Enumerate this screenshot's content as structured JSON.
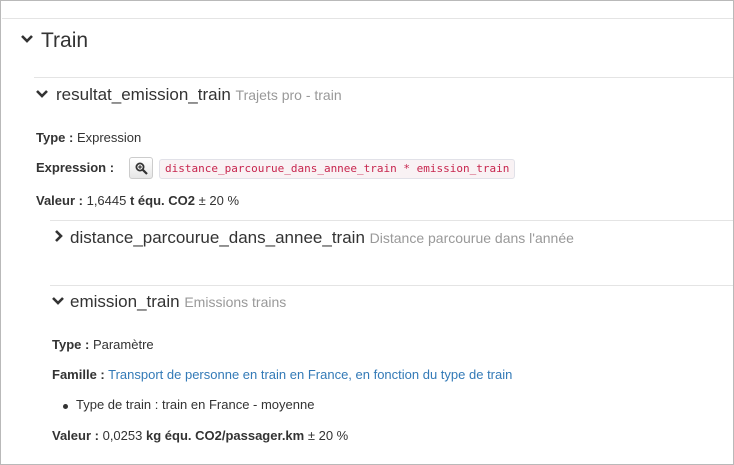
{
  "section": {
    "title": "Train"
  },
  "resultat": {
    "name": "resultat_emission_train",
    "description": "Trajets pro - train",
    "type_label": "Type :",
    "type_value": "Expression",
    "expression_label": "Expression :",
    "expression_value": "distance_parcourue_dans_annee_train * emission_train",
    "valeur_label": "Valeur :",
    "valeur_number": "1,6445",
    "valeur_unit": "t équ. CO2",
    "valeur_uncertainty": "± 20 %"
  },
  "distance": {
    "name": "distance_parcourue_dans_annee_train",
    "description": "Distance parcourue dans l'année"
  },
  "emission": {
    "name": "emission_train",
    "description": "Emissions trains",
    "type_label": "Type :",
    "type_value": "Paramètre",
    "famille_label": "Famille :",
    "famille_link": "Transport de personne en train en France, en fonction du type de train",
    "bullet_text": "Type de train : train en France - moyenne",
    "valeur_label": "Valeur :",
    "valeur_number": "0,0253",
    "valeur_unit": "kg équ. CO2/passager.km",
    "valeur_uncertainty": "± 20 %"
  },
  "icons": {
    "expanded": "chevron-down-icon",
    "collapsed": "chevron-right-icon",
    "zoom": "zoom-icon"
  }
}
